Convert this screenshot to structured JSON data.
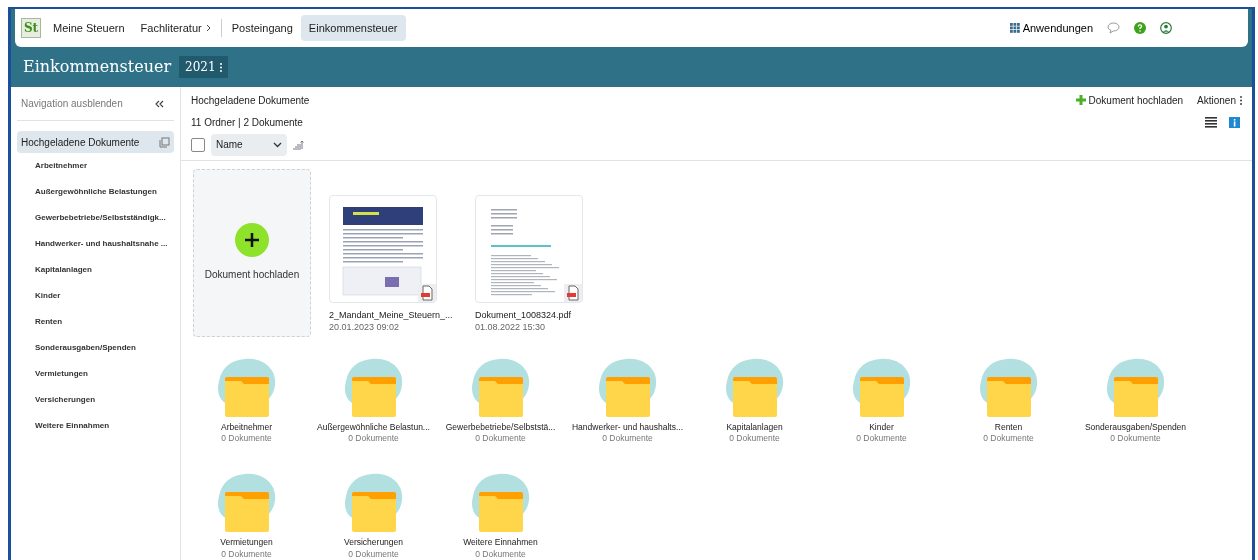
{
  "topbar": {
    "logo": "St",
    "nav": [
      {
        "label": "Meine Steuern",
        "selected": false,
        "kind": "link"
      },
      {
        "label": "Fachliteratur",
        "selected": false,
        "kind": "menu"
      },
      {
        "label": "Posteingang",
        "selected": false,
        "kind": "link"
      },
      {
        "label": "Einkommensteuer",
        "selected": true,
        "kind": "link"
      }
    ],
    "apps": "Anwendungen"
  },
  "header": {
    "title": "Einkommensteuer",
    "year": "2021"
  },
  "sidebar": {
    "toggle": "Navigation ausblenden",
    "items": [
      {
        "label": "Hochgeladene Dokumente",
        "selected": true,
        "children": [
          {
            "label": "Arbeitnehmer",
            "selected": false
          },
          {
            "label": "Außergewöhnliche Belastungen",
            "selected": false
          },
          {
            "label": "Gewerbebetriebe/Selbstständigk...",
            "selected": false
          },
          {
            "label": "Handwerker- und haushaltsnahe ...",
            "selected": false
          },
          {
            "label": "Kapitalanlagen",
            "selected": false
          },
          {
            "label": "Kinder",
            "selected": false
          },
          {
            "label": "Renten",
            "selected": false
          },
          {
            "label": "Sonderausgaben/Spenden",
            "selected": false
          },
          {
            "label": "Vermietungen",
            "selected": false
          },
          {
            "label": "Versicherungen",
            "selected": false
          },
          {
            "label": "Weitere Einnahmen",
            "selected": false
          }
        ]
      }
    ]
  },
  "content": {
    "breadcrumb": "Hochgeladene Dokumente",
    "upload_action": "Dokument hochladen",
    "actions": "Aktionen",
    "summary": "11 Ordner | 2 Dokumente",
    "select_all": {
      "checked": false
    },
    "sort": {
      "value": "Name"
    },
    "upload_tile": "Dokument hochladen",
    "documents": [
      {
        "name": "2_Mandant_Meine_Steuern_...",
        "date": "20.01.2023 09:02",
        "kind": "newsletter"
      },
      {
        "name": "Dokument_1008324.pdf",
        "date": "01.08.2022 15:30",
        "kind": "letter"
      }
    ],
    "folders": [
      {
        "name": "Arbeitnehmer",
        "count": "0 Dokumente"
      },
      {
        "name": "Außergewöhnliche Belastun...",
        "count": "0 Dokumente"
      },
      {
        "name": "Gewerbebetriebe/Selbststä...",
        "count": "0 Dokumente"
      },
      {
        "name": "Handwerker- und haushalts...",
        "count": "0 Dokumente"
      },
      {
        "name": "Kapitalanlagen",
        "count": "0 Dokumente"
      },
      {
        "name": "Kinder",
        "count": "0 Dokumente"
      },
      {
        "name": "Renten",
        "count": "0 Dokumente"
      },
      {
        "name": "Sonderausgaben/Spenden",
        "count": "0 Dokumente"
      },
      {
        "name": "Vermietungen",
        "count": "0 Dokumente"
      },
      {
        "name": "Versicherungen",
        "count": "0 Dokumente"
      },
      {
        "name": "Weitere Einnahmen",
        "count": "0 Dokumente"
      }
    ]
  }
}
